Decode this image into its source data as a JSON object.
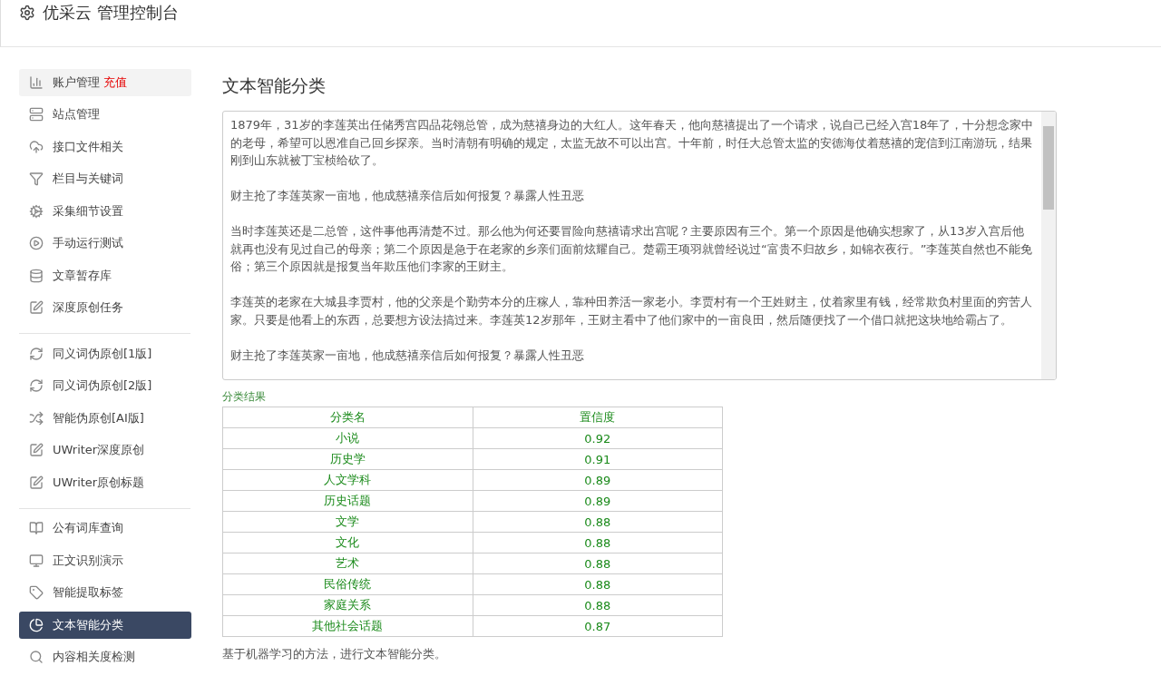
{
  "header": {
    "title": "优采云 管理控制台"
  },
  "sidebar": {
    "groups": [
      [
        {
          "label": "账户管理",
          "badge": "充值",
          "selected": false,
          "hovered": true
        },
        {
          "label": "站点管理",
          "selected": false,
          "hovered": false
        },
        {
          "label": "接口文件相关",
          "selected": false,
          "hovered": false
        },
        {
          "label": "栏目与关键词",
          "selected": false,
          "hovered": false
        },
        {
          "label": "采集细节设置",
          "selected": false,
          "hovered": false
        },
        {
          "label": "手动运行测试",
          "selected": false,
          "hovered": false
        },
        {
          "label": "文章暂存库",
          "selected": false,
          "hovered": false
        },
        {
          "label": "深度原创任务",
          "selected": false,
          "hovered": false
        }
      ],
      [
        {
          "label": "同义词伪原创[1版]",
          "selected": false,
          "hovered": false
        },
        {
          "label": "同义词伪原创[2版]",
          "selected": false,
          "hovered": false
        },
        {
          "label": "智能伪原创[AI版]",
          "selected": false,
          "hovered": false
        },
        {
          "label": "UWriter深度原创",
          "selected": false,
          "hovered": false
        },
        {
          "label": "UWriter原创标题",
          "selected": false,
          "hovered": false
        }
      ],
      [
        {
          "label": "公有词库查询",
          "selected": false,
          "hovered": false
        },
        {
          "label": "正文识别演示",
          "selected": false,
          "hovered": false
        },
        {
          "label": "智能提取标签",
          "selected": false,
          "hovered": false
        },
        {
          "label": "文本智能分类",
          "selected": true,
          "hovered": false
        },
        {
          "label": "内容相关度检测",
          "selected": false,
          "hovered": false
        }
      ]
    ]
  },
  "main": {
    "title": "文本智能分类",
    "text_area": {
      "paragraphs": [
        "1879年，31岁的李莲英出任储秀宫四品花翎总管，成为慈禧身边的大红人。这年春天，他向慈禧提出了一个请求，说自己已经入宫18年了，十分想念家中的老母，希望可以恩准自己回乡探亲。当时清朝有明确的规定，太监无故不可以出宫。十年前，时任大总管太监的安德海仗着慈禧的宠信到江南游玩，结果刚到山东就被丁宝桢给砍了。",
        "财主抢了李莲英家一亩地，他成慈禧亲信后如何报复？暴露人性丑恶",
        "当时李莲英还是二总管，这件事他再清楚不过。那么他为何还要冒险向慈禧请求出宫呢？主要原因有三个。第一个原因是他确实想家了，从13岁入宫后他就再也没有见过自己的母亲；第二个原因是急于在老家的乡亲们面前炫耀自己。楚霸王项羽就曾经说过“富贵不归故乡，如锦衣夜行。”李莲英自然也不能免俗；第三个原因就是报复当年欺压他们李家的王财主。",
        "李莲英的老家在大城县李贾村，他的父亲是个勤劳本分的庄稼人，靠种田养活一家老小。李贾村有一个王姓财主，仗着家里有钱，经常欺负村里面的穷苦人家。只要是他看上的东西，总要想方设法搞过来。李莲英12岁那年，王财主看中了他们家中的一亩良田，然后随便找了一个借口就把这块地给霸占了。",
        "财主抢了李莲英家一亩地，他成慈禧亲信后如何报复？暴露人性丑恶"
      ]
    },
    "results": {
      "caption": "分类结果",
      "columns": [
        "分类名",
        "置信度"
      ],
      "rows": [
        [
          "小说",
          "0.92"
        ],
        [
          "历史学",
          "0.91"
        ],
        [
          "人文学科",
          "0.89"
        ],
        [
          "历史话题",
          "0.89"
        ],
        [
          "文学",
          "0.88"
        ],
        [
          "文化",
          "0.88"
        ],
        [
          "艺术",
          "0.88"
        ],
        [
          "民俗传统",
          "0.88"
        ],
        [
          "家庭关系",
          "0.88"
        ],
        [
          "其他社会话题",
          "0.87"
        ]
      ]
    },
    "note": "基于机器学习的方法，进行文本智能分类。"
  }
}
